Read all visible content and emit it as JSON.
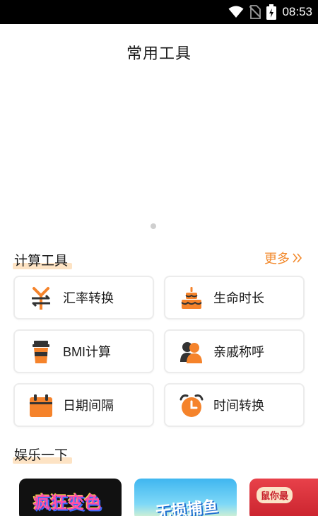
{
  "status_bar": {
    "time": "08:53",
    "icons": [
      "wifi-icon",
      "no-sim-icon",
      "battery-charging-icon"
    ]
  },
  "header": {
    "title": "常用工具"
  },
  "banner": {
    "dots": 1
  },
  "calc_section": {
    "title": "计算工具",
    "more_label": "更多",
    "more_icon": "double-chevron-right-icon",
    "tools": [
      {
        "label": "汇率转换",
        "icon": "yen-exchange-icon"
      },
      {
        "label": "生命时长",
        "icon": "birthday-cake-icon"
      },
      {
        "label": "BMI计算",
        "icon": "cup-icon"
      },
      {
        "label": "亲戚称呼",
        "icon": "people-icon"
      },
      {
        "label": "日期间隔",
        "icon": "calendar-icon"
      },
      {
        "label": "时间转换",
        "icon": "alarm-clock-icon"
      }
    ]
  },
  "fun_section": {
    "title": "娱乐一下",
    "games": [
      {
        "title": "疯狂变色"
      },
      {
        "title": "无损捕鱼"
      },
      {
        "title": "鼠你最"
      }
    ]
  },
  "colors": {
    "accent": "#f28a2e",
    "icon_orange": "#f5832b",
    "highlight": "#fde3c4",
    "card_border": "#ececec"
  }
}
